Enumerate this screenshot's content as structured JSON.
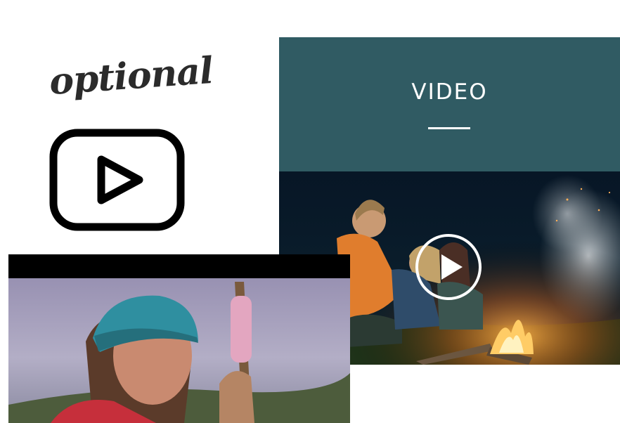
{
  "annotation": {
    "optional_label": "optional"
  },
  "icons": {
    "youtube": "youtube-play-icon",
    "play": "play-circle-icon"
  },
  "video_section": {
    "title": "VIDEO",
    "header_color": "#305b63"
  }
}
